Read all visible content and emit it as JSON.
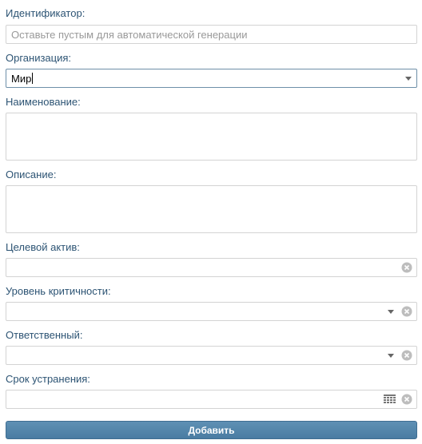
{
  "fields": {
    "identifier": {
      "label": "Идентификатор:",
      "placeholder": "Оставьте пустым для автоматической генерации"
    },
    "organization": {
      "label": "Организация:",
      "value": "Мир"
    },
    "name": {
      "label": "Наименование:"
    },
    "description": {
      "label": "Описание:"
    },
    "target_asset": {
      "label": "Целевой актив:"
    },
    "criticality": {
      "label": "Уровень критичности:"
    },
    "responsible": {
      "label": "Ответственный:"
    },
    "deadline": {
      "label": "Срок устранения:"
    }
  },
  "submit_label": "Добавить",
  "icons": {
    "dropdown": "chevron-down-icon",
    "clear": "clear-icon",
    "calendar": "calendar-icon"
  },
  "colors": {
    "label": "#2d5474",
    "button": "#5585a9",
    "border": "#d3d3d3"
  }
}
